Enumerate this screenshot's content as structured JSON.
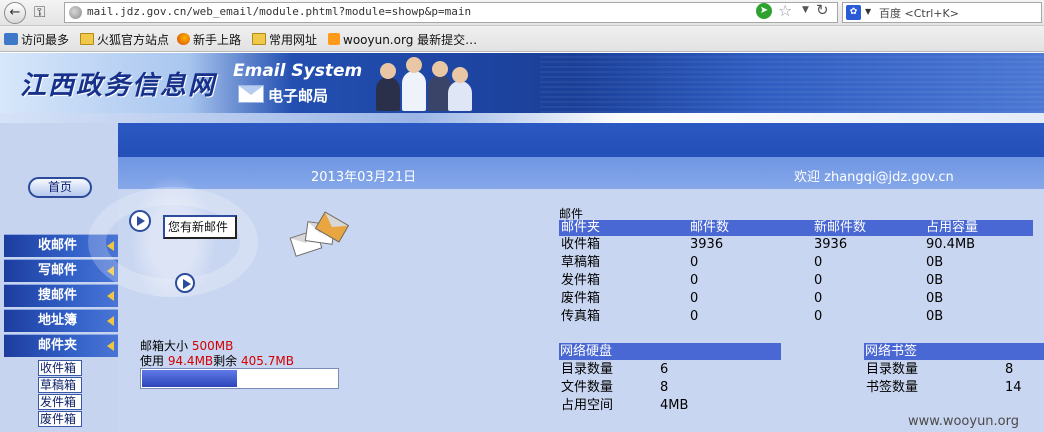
{
  "browser": {
    "url": "mail.jdz.gov.cn/web_email/module.phtml?module=showp&p=main",
    "search_engine": "百度",
    "search_placeholder": "<Ctrl+K>",
    "bookmarks": [
      "访问最多",
      "火狐官方站点",
      "新手上路",
      "常用网址",
      "wooyun.org 最新提交…"
    ]
  },
  "banner": {
    "site_title": "江西政务信息网",
    "product_title": "Email System",
    "product_subtitle": "电子邮局"
  },
  "sidebar": {
    "home_label": "首页",
    "nav_items": [
      "收邮件",
      "写邮件",
      "搜邮件",
      "地址簿",
      "邮件夹"
    ],
    "sub_items": [
      "收件箱",
      "草稿箱",
      "发件箱",
      "废件箱"
    ]
  },
  "status": {
    "date": "2013年03月21日",
    "welcome": "欢迎 zhangqi@jdz.gov.cn"
  },
  "new_mail": {
    "label": "您有新邮件"
  },
  "quota": {
    "size_label": "邮箱大小",
    "size_value": "500MB",
    "used_label": "使用",
    "used_value": "94.4MB",
    "remaining_label": "剩余",
    "remaining_value": "405.7MB",
    "used_fraction": 0.189
  },
  "folders": {
    "section_label": "邮件",
    "headers": [
      "邮件夹",
      "邮件数",
      "新邮件数",
      "占用容量"
    ],
    "rows": [
      [
        "收件箱",
        "3936",
        "3936",
        "90.4MB"
      ],
      [
        "草稿箱",
        "0",
        "0",
        "0B"
      ],
      [
        "发件箱",
        "0",
        "0",
        "0B"
      ],
      [
        "废件箱",
        "0",
        "0",
        "0B"
      ],
      [
        "传真箱",
        "0",
        "0",
        "0B"
      ]
    ]
  },
  "netdisk": {
    "title": "网络硬盘",
    "rows": [
      [
        "目录数量",
        "6"
      ],
      [
        "文件数量",
        "8"
      ],
      [
        "占用空间",
        "4MB"
      ]
    ]
  },
  "netbookmarks": {
    "title": "网络书签",
    "rows": [
      [
        "目录数量",
        "8"
      ],
      [
        "书签数量",
        "14"
      ]
    ]
  },
  "watermark": "www.wooyun.org",
  "colors": {
    "accent_blue": "#4a68d3",
    "quota_red": "#d20000",
    "banner_blue": "#1a3f98"
  }
}
